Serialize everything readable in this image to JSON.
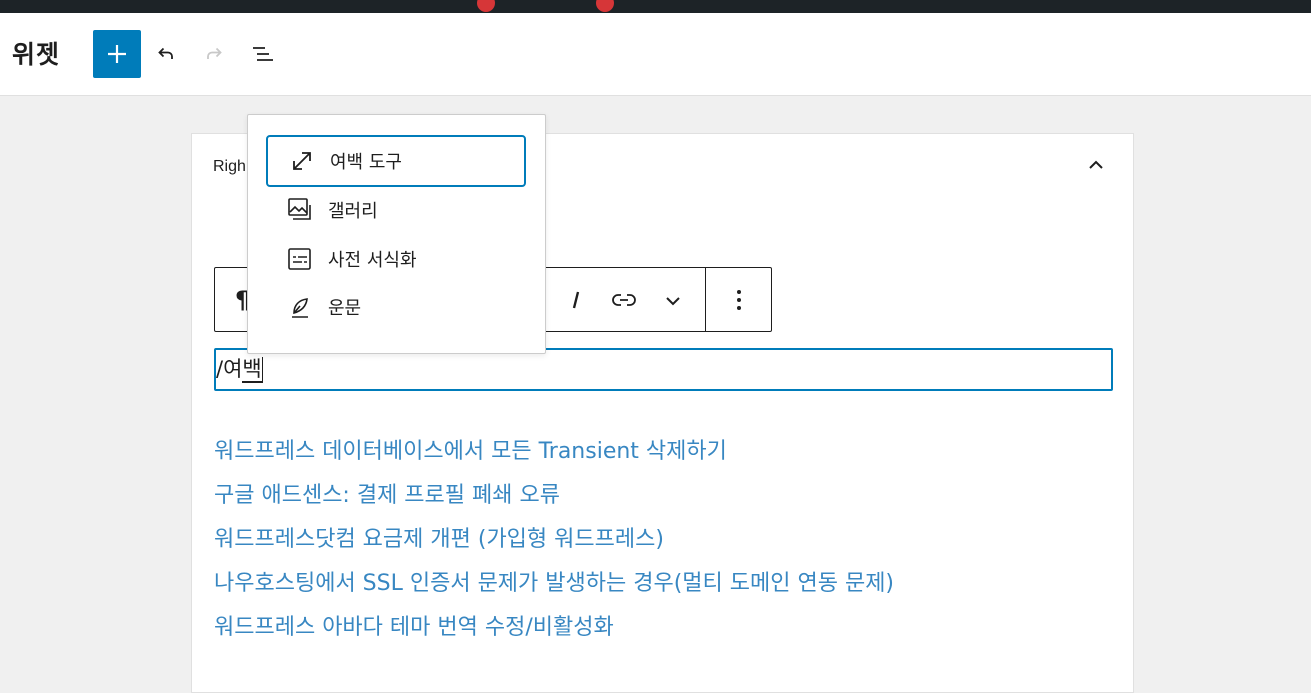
{
  "header": {
    "title": "위젯"
  },
  "widget": {
    "title_partial": "Righ"
  },
  "editor": {
    "slash": "/여",
    "composing": "백"
  },
  "recent_posts": [
    "워드프레스 데이터베이스에서 모든 Transient 삭제하기",
    "구글 애드센스: 결제 프로필 폐쇄 오류",
    "워드프레스닷컴 요금제 개편 (가입형 워드프레스)",
    "나우호스팅에서 SSL 인증서 문제가 발생하는 경우(멀티 도메인 연동 문제)",
    "워드프레스 아바다 테마 번역 수정/비활성화"
  ],
  "autocomplete": {
    "options": [
      {
        "label": "여백 도구",
        "icon": "resize-arrow-icon",
        "selected": true
      },
      {
        "label": "갤러리",
        "icon": "gallery-icon",
        "selected": false
      },
      {
        "label": "사전 서식화",
        "icon": "preformatted-icon",
        "selected": false
      },
      {
        "label": "운문",
        "icon": "quill-icon",
        "selected": false
      }
    ]
  },
  "colors": {
    "accent": "#007cba",
    "link": "#3887c2",
    "admin_bar": "#1d2327"
  }
}
